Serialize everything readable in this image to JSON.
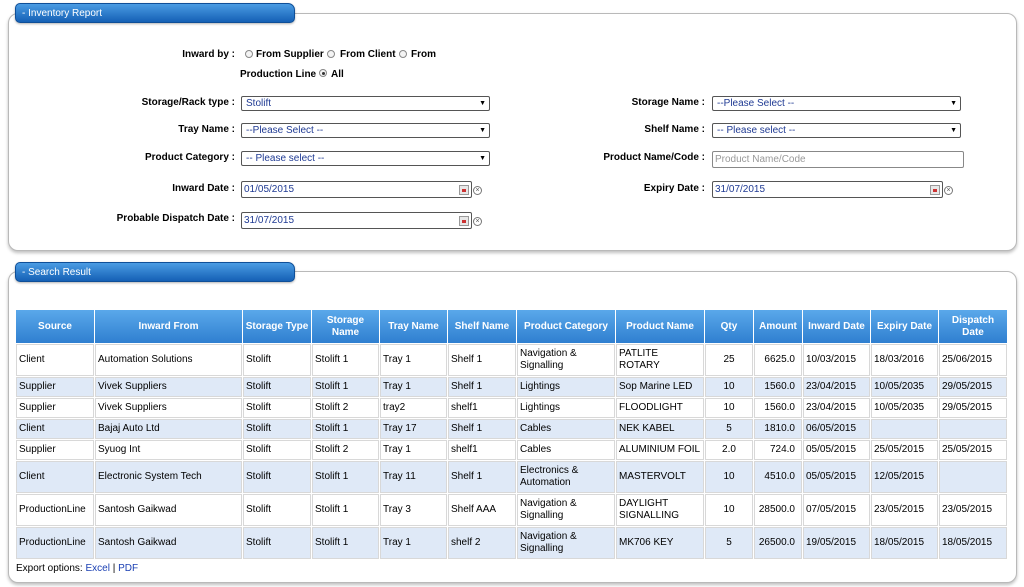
{
  "filter_panel": {
    "title": "- Inventory Report",
    "inward_by": {
      "label": "Inward by :",
      "options": [
        "From Supplier",
        "From Client",
        "From",
        "Production Line",
        "All"
      ]
    },
    "storage_rack_type": {
      "label": "Storage/Rack type :",
      "value": "Stolift"
    },
    "storage_name": {
      "label": "Storage Name :",
      "value": "--Please Select --"
    },
    "tray_name": {
      "label": "Tray Name :",
      "value": "--Please Select --"
    },
    "shelf_name": {
      "label": "Shelf Name :",
      "value": "-- Please select --"
    },
    "product_category": {
      "label": "Product Category :",
      "value": "-- Please select --"
    },
    "product_name_code": {
      "label": "Product Name/Code :",
      "placeholder": "Product Name/Code"
    },
    "inward_date": {
      "label": "Inward Date :",
      "value": "01/05/2015"
    },
    "expiry_date": {
      "label": "Expiry Date :",
      "value": "31/07/2015"
    },
    "probable_dispatch_date": {
      "label": "Probable Dispatch Date :",
      "value": "31/07/2015"
    }
  },
  "result_panel": {
    "title": "- Search Result",
    "columns": [
      "Source",
      "Inward From",
      "Storage Type",
      "Storage Name",
      "Tray Name",
      "Shelf Name",
      "Product Category",
      "Product Name",
      "Qty",
      "Amount",
      "Inward Date",
      "Expiry Date",
      "Dispatch Date"
    ],
    "rows": [
      [
        "Client",
        "Automation Solutions",
        "Stolift",
        "Stolift 1",
        "Tray 1",
        "Shelf 1",
        "Navigation & Signalling",
        "PATLITE ROTARY",
        "25",
        "6625.0",
        "10/03/2015",
        "18/03/2016",
        "25/06/2015"
      ],
      [
        "Supplier",
        "Vivek Suppliers",
        "Stolift",
        "Stolift 1",
        "Tray 1",
        "Shelf 1",
        "Lightings",
        "Sop Marine LED",
        "10",
        "1560.0",
        "23/04/2015",
        "10/05/2035",
        "29/05/2015"
      ],
      [
        "Supplier",
        "Vivek Suppliers",
        "Stolift",
        "Stolift 2",
        "tray2",
        "shelf1",
        "Lightings",
        "FLOODLIGHT",
        "10",
        "1560.0",
        "23/04/2015",
        "10/05/2035",
        "29/05/2015"
      ],
      [
        "Client",
        "Bajaj Auto Ltd",
        "Stolift",
        "Stolift 1",
        "Tray 17",
        "Shelf 1",
        "Cables",
        "NEK KABEL",
        "5",
        "1810.0",
        "06/05/2015",
        "",
        ""
      ],
      [
        "Supplier",
        "Syuog Int",
        "Stolift",
        "Stolift 2",
        "Tray 1",
        "shelf1",
        "Cables",
        "ALUMINIUM FOIL",
        "2.0",
        "724.0",
        "05/05/2015",
        "25/05/2015",
        "25/05/2015"
      ],
      [
        "Client",
        "Electronic System Tech",
        "Stolift",
        "Stolift 1",
        "Tray 11",
        "Shelf 1",
        "Electronics & Automation",
        "MASTERVOLT",
        "10",
        "4510.0",
        "05/05/2015",
        "12/05/2015",
        ""
      ],
      [
        "ProductionLine",
        "Santosh Gaikwad",
        "Stolift",
        "Stolift 1",
        "Tray 3",
        "Shelf AAA",
        "Navigation & Signalling",
        "DAYLIGHT SIGNALLING",
        "10",
        "28500.0",
        "07/05/2015",
        "23/05/2015",
        "23/05/2015"
      ],
      [
        "ProductionLine",
        "Santosh Gaikwad",
        "Stolift",
        "Stolift 1",
        "Tray 1",
        "shelf 2",
        "Navigation & Signalling",
        "MK706 KEY",
        "5",
        "26500.0",
        "19/05/2015",
        "18/05/2015",
        "18/05/2015"
      ]
    ],
    "export": {
      "label": "Export options:",
      "excel": "Excel",
      "separator": "|",
      "pdf": "PDF"
    }
  }
}
